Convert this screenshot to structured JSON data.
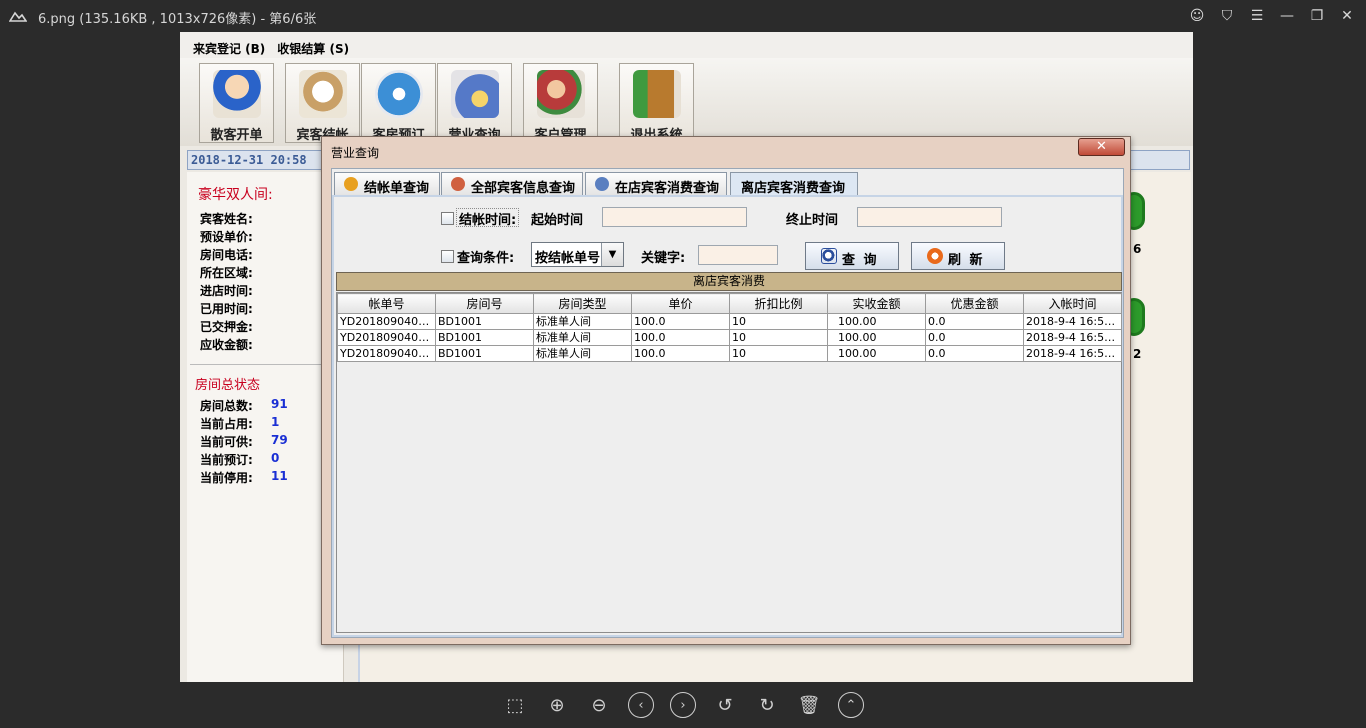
{
  "viewer": {
    "title": "6.png (135.16KB , 1013x726像素) - 第6/6张"
  },
  "app": {
    "menu": [
      {
        "label": "来宾登记 (B)"
      },
      {
        "label": "收银结算 (S)"
      }
    ],
    "toolbar": [
      {
        "label": "散客开单",
        "icon": "guest-checkin-icon",
        "color": "#e9b86b"
      },
      {
        "label": "宾客结帐",
        "icon": "astronaut-icon",
        "color": "#d8b77a"
      },
      {
        "label": "客房预订",
        "icon": "compass-icon",
        "color": "#5aa0d8"
      },
      {
        "label": "营业查询",
        "icon": "magnifier-folder-icon",
        "color": "#6c8fd1"
      },
      {
        "label": "客户管理",
        "icon": "customer-icon",
        "color": "#c05555"
      },
      {
        "label": "退出系统",
        "icon": "exit-door-icon",
        "color": "#c98c3a"
      }
    ],
    "datetime": "2018-12-31 20:58",
    "left_panel": {
      "room_title": "豪华双人间:",
      "fields": [
        "宾客姓名:",
        "预设单价:",
        "房间电话:",
        "所在区域:",
        "进店时间:",
        "已用时间:",
        "已交押金:",
        "应收金额:"
      ],
      "status_title": "房间总状态",
      "stats": [
        {
          "label": "房间总数:",
          "value": "91"
        },
        {
          "label": "当前占用:",
          "value": "1"
        },
        {
          "label": "当前可供:",
          "value": "79"
        },
        {
          "label": "当前预订:",
          "value": "0"
        },
        {
          "label": "当前停用:",
          "value": "11"
        }
      ]
    },
    "room_nodes": [
      "6",
      "2"
    ]
  },
  "dialog": {
    "title": "营业查询",
    "close_label": "✕",
    "tabs": [
      {
        "label": "结帐单查询",
        "icon_color": "#e8a020"
      },
      {
        "label": "全部宾客信息查询",
        "icon_color": "#d06040"
      },
      {
        "label": "在店宾客消费查询",
        "icon_color": "#5a7fc0"
      },
      {
        "label": "离店宾客消费查询",
        "active": true
      }
    ],
    "filters": {
      "checkout_time_label": "结帐时间:",
      "start_label": "起始时间",
      "start_value": "",
      "end_label": "终止时间",
      "end_value": "",
      "condition_label": "查询条件:",
      "condition_selected": "按结帐单号",
      "keyword_label": "关键字:",
      "keyword_value": "",
      "query_btn": "查 询",
      "refresh_btn": "刷 新"
    },
    "grid": {
      "title": "离店宾客消费",
      "columns": [
        "帐单号",
        "房间号",
        "房间类型",
        "单价",
        "折扣比例",
        "实收金额",
        "优惠金额",
        "入帐时间"
      ],
      "rows": [
        [
          "YD2018090400...",
          "BD1001",
          "标准单人间",
          "100.0",
          "10",
          "100.00",
          "0.0",
          "2018-9-4 16:54..."
        ],
        [
          "YD2018090400...",
          "BD1001",
          "标准单人间",
          "100.0",
          "10",
          "100.00",
          "0.0",
          "2018-9-4 16:54..."
        ],
        [
          "YD2018090400...",
          "BD1001",
          "标准单人间",
          "100.0",
          "10",
          "100.00",
          "0.0",
          "2018-9-4 16:54..."
        ]
      ]
    }
  }
}
